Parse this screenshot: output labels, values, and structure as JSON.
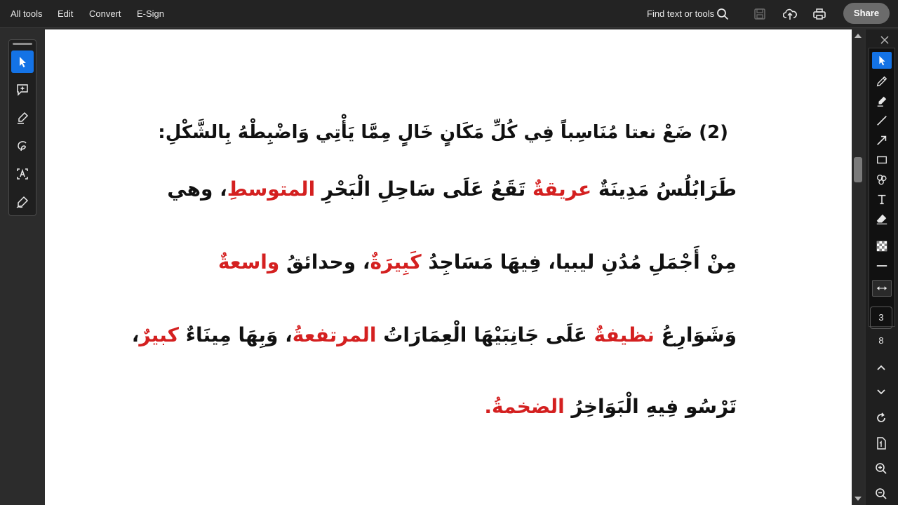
{
  "menubar": {
    "items": [
      "All tools",
      "Edit",
      "Convert",
      "E-Sign"
    ],
    "find_label": "Find text or tools",
    "share_label": "Share"
  },
  "icons": {
    "top": [
      "search-icon",
      "save-icon",
      "upload-cloud-icon",
      "print-icon"
    ],
    "left_tools": [
      "cursor-icon",
      "add-comment-icon",
      "highlight-pen-icon",
      "draw-icon",
      "text-recognition-icon",
      "sign-icon"
    ],
    "right_tools": [
      "cursor-icon",
      "pencil-icon",
      "highlighter-icon",
      "line-icon",
      "arrow-icon",
      "rectangle-icon",
      "stamp-icon",
      "text-icon",
      "eraser-icon",
      "opacity-icon",
      "stroke-width-icon",
      "fit-width-icon"
    ]
  },
  "colors": {
    "accent": "#1473e6",
    "answer_red": "#d42020"
  },
  "document": {
    "heading": "(2) ضَعْ نعتا مُنَاسِباً فِي كُلِّ مَكَانٍ خَالٍ مِمَّا يَأْتِي وَاضْبِطْهُ بِالشَّكْلِ:",
    "line1": {
      "a": "طَرَابُلُسُ مَدِينَةٌ ",
      "b": "عريقةٌ",
      "c": " تَقَعُ عَلَى سَاحِلِ الْبَحْرِ ",
      "d": "المتوسطِ",
      "e": "، وهي"
    },
    "line2": {
      "a": "مِنْ أَجْمَلِ مُدُنِ ليبيا، فِيهَا مَسَاجِدُ ",
      "b": "كَبِيرَةٌ",
      "c": "، وحدائقُ ",
      "d": "واسعةٌ"
    },
    "line3": {
      "a": "وَشَوَارِعُ ",
      "b": "نظيفةٌ",
      "c": " عَلَى جَانِبَيْهَا الْعِمَارَاتُ ",
      "d": "المرتفعةُ",
      "e": "، وَبِهَا مِينَاءٌ ",
      "f": "كبيرٌ",
      "g": "،"
    },
    "line4": {
      "a": "تَرْسُو فِيهِ الْبَوَاخِرُ ",
      "b": "الضخمةُ",
      "c": "."
    }
  },
  "page_nav": {
    "current_page": "3",
    "total_pages": "8"
  }
}
